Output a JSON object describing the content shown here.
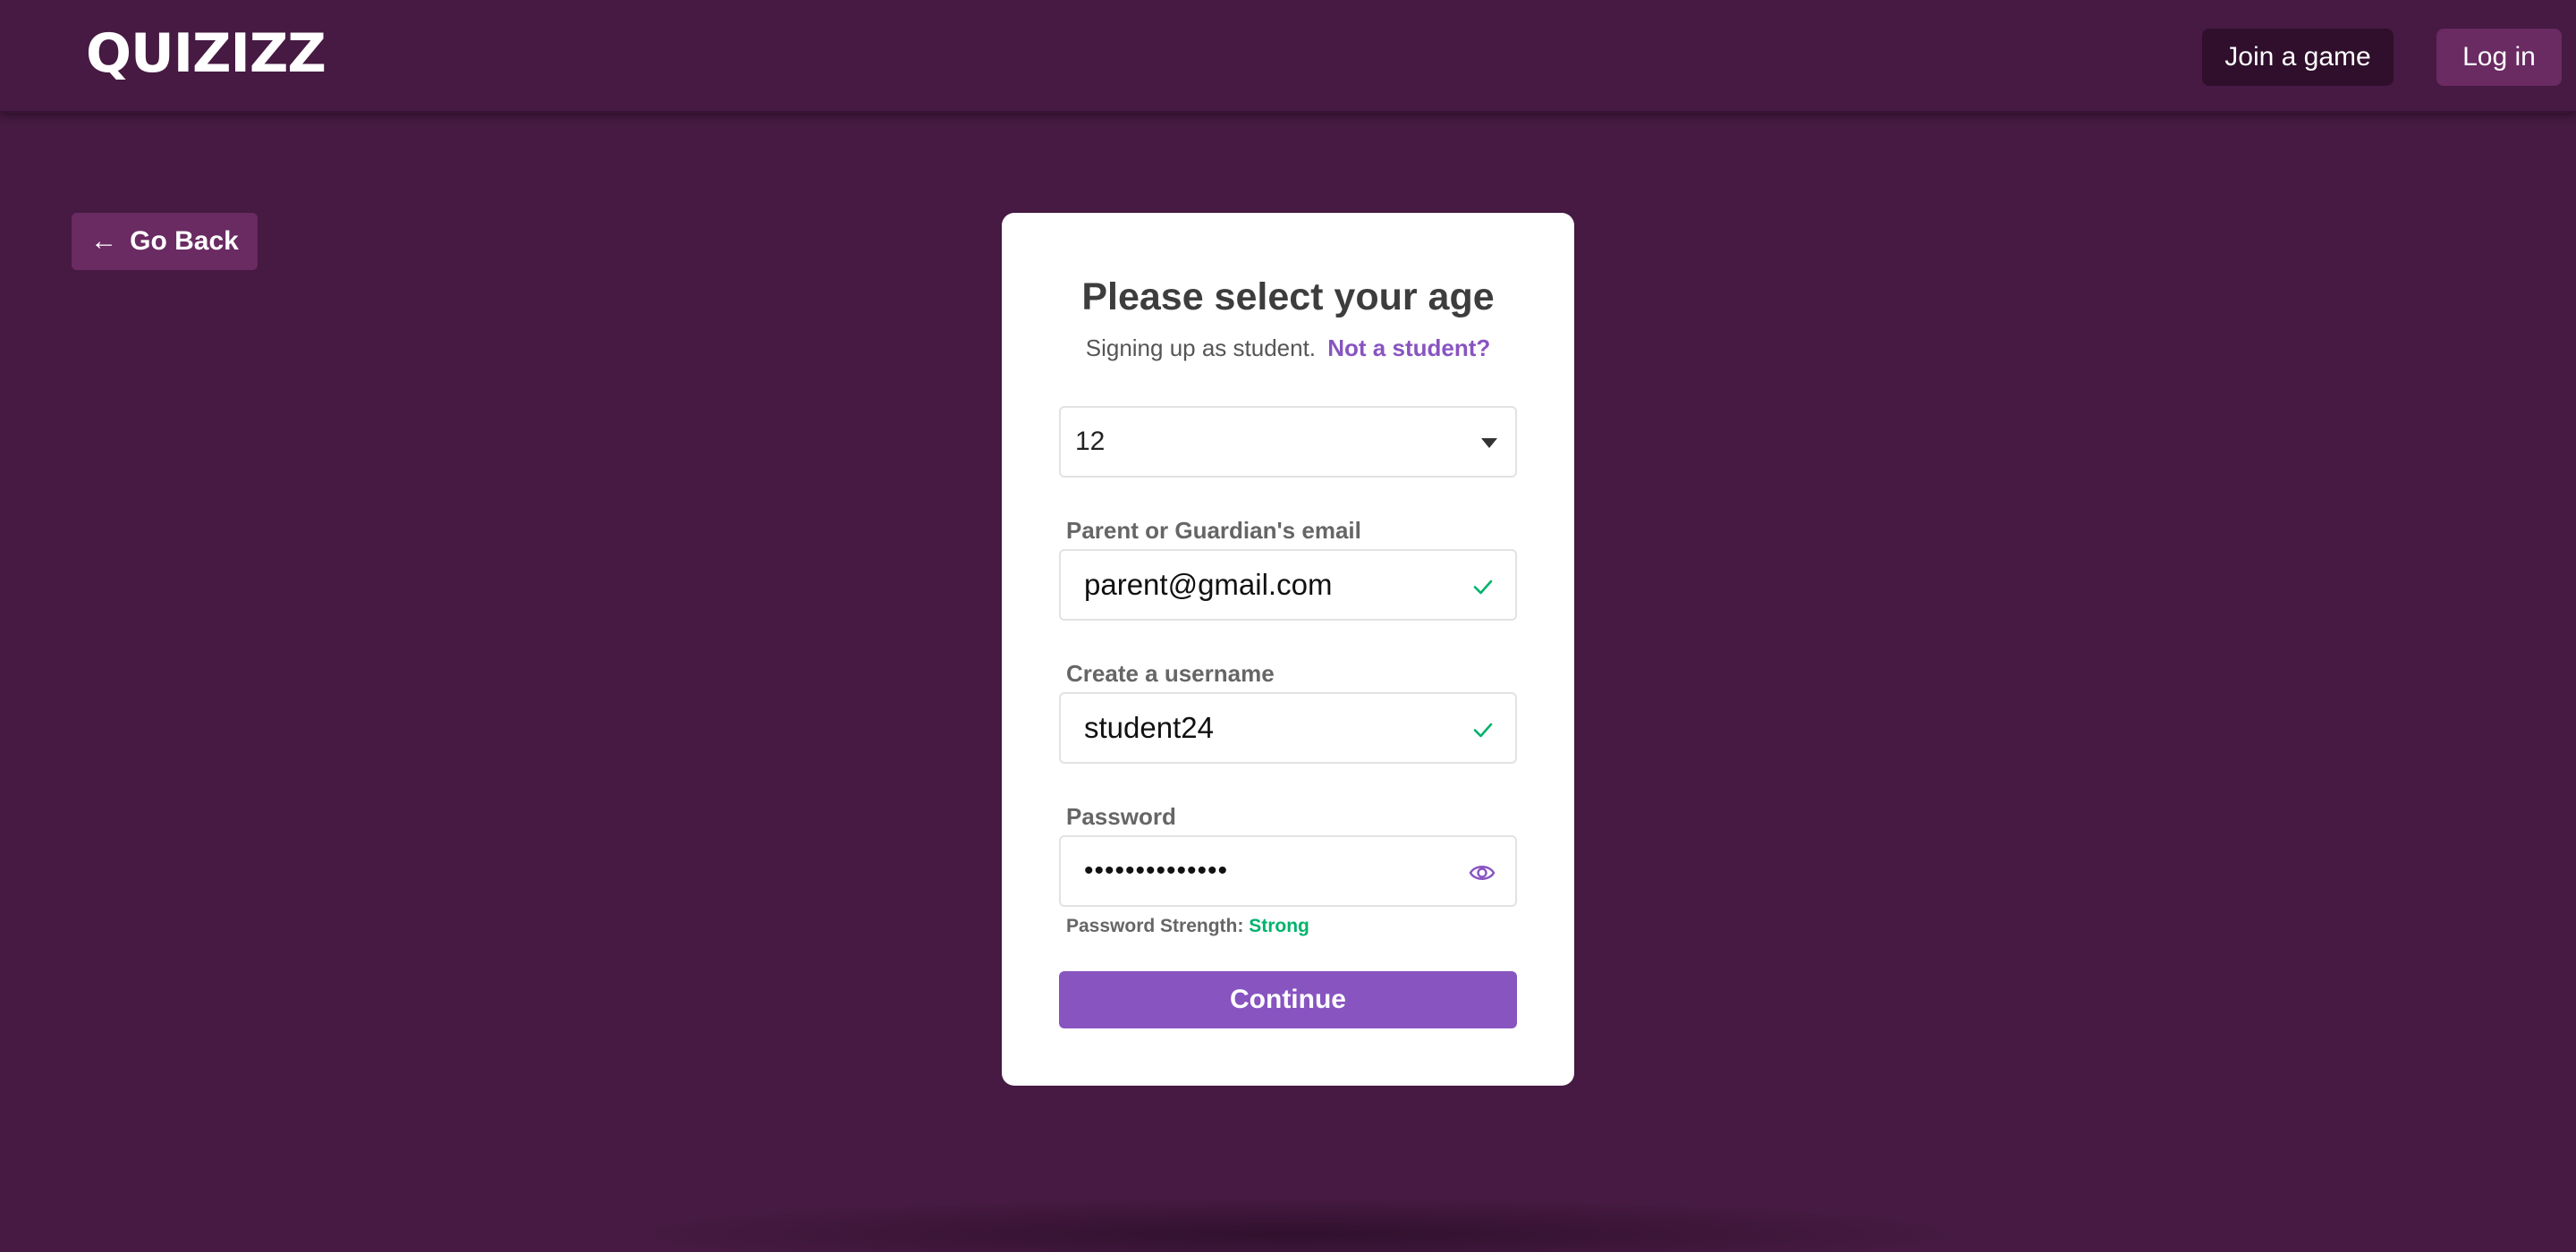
{
  "header": {
    "logo_text": "QUIZIZZ",
    "join_label": "Join a game",
    "login_label": "Log in"
  },
  "nav": {
    "back_label": "Go Back",
    "back_icon": "arrow-left-icon"
  },
  "form": {
    "title": "Please select your age",
    "subtitle": "Signing up as student.",
    "not_student_link": "Not a student?",
    "age_value": "12",
    "email_label": "Parent or Guardian's email",
    "email_value": "parent@gmail.com",
    "username_label": "Create a username",
    "username_value": "student24",
    "password_label": "Password",
    "password_value": "••••••••••••••",
    "strength_label": "Password Strength:",
    "strength_value": "Strong",
    "continue_label": "Continue"
  },
  "colors": {
    "background": "#461a42",
    "accent": "#8854c0",
    "success": "#00b36b"
  }
}
